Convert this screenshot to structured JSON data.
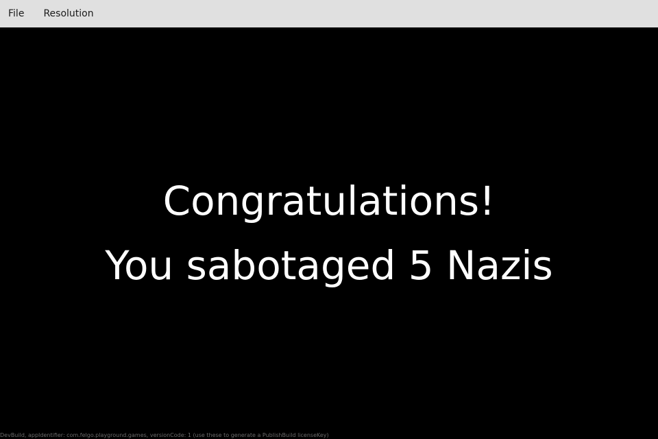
{
  "menubar": {
    "items": [
      {
        "label": "File"
      },
      {
        "label": "Resolution"
      }
    ]
  },
  "game": {
    "title_line": "Congratulations!",
    "result_line": "You sabotaged 5 Nazis"
  },
  "footer": {
    "text": "DevBuild, appIdentifier: com.felgo.playground.games, versionCode: 1 (use these to generate a PublishBuild licenseKey)"
  },
  "colors": {
    "menubar_bg": "#e0e0e0",
    "stage_bg": "#000000",
    "message_text": "#ffffff",
    "footer_text": "#6a6a6a"
  }
}
